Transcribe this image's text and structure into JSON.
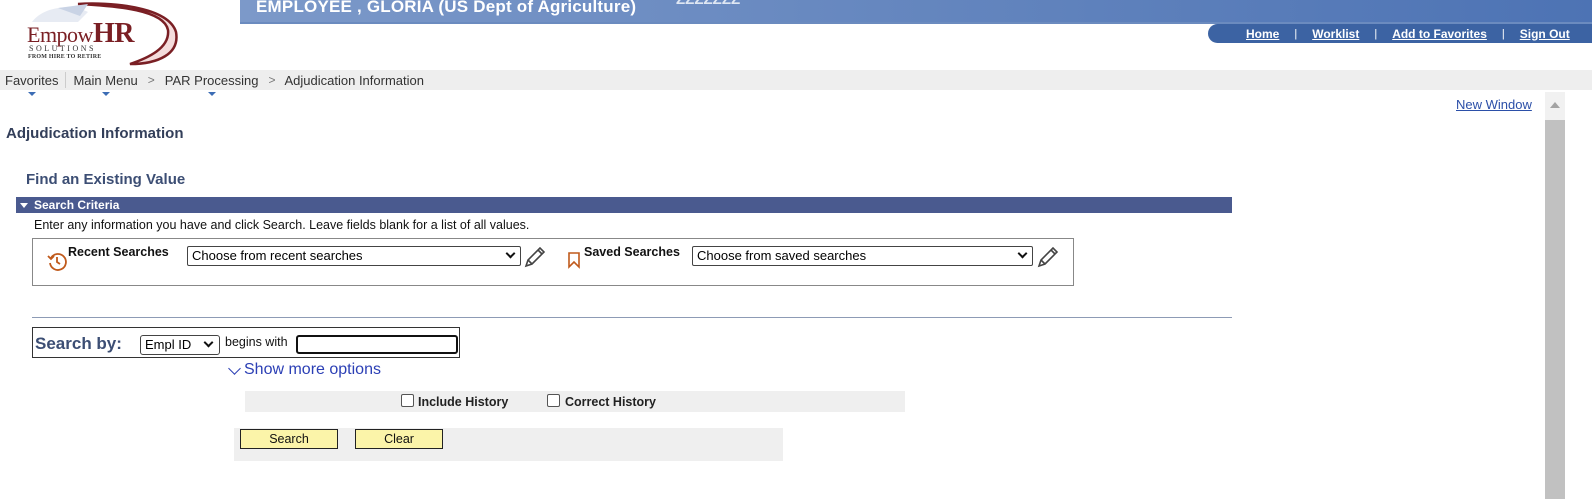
{
  "banner": {
    "title": "EMPLOYEE , GLORIA (US Dept of Agriculture)",
    "ghost": "ZZZZZZZ"
  },
  "logo": {
    "name_prefix": "Empow",
    "name_suffix": "HR",
    "sub": "SOLUTIONS",
    "tagline": "FROM HIRE TO RETIRE"
  },
  "nav": {
    "home": "Home",
    "worklist": "Worklist",
    "add_favorites": "Add to Favorites",
    "sign_out": "Sign Out",
    "separator": "|"
  },
  "breadcrumb": {
    "favorites": "Favorites",
    "main_menu": "Main Menu",
    "par_processing": "PAR Processing",
    "current": "Adjudication Information",
    "arrow": ">"
  },
  "page": {
    "new_window": "New Window",
    "title": "Adjudication Information",
    "find_title": "Find an Existing Value"
  },
  "criteria": {
    "header": "Search Criteria",
    "instructions": "Enter any information you have and click Search. Leave fields blank for a list of all values.",
    "recent_label": "Recent Searches",
    "recent_value": "Choose from recent searches",
    "saved_label": "Saved Searches",
    "saved_value": "Choose from saved searches"
  },
  "search_by": {
    "label": "Search by:",
    "field_value": "Empl ID",
    "operator": "begins with",
    "input_value": ""
  },
  "options": {
    "show_more": "Show more options",
    "include_history": "Include History",
    "correct_history": "Correct History",
    "include_history_checked": false,
    "correct_history_checked": false
  },
  "buttons": {
    "search": "Search",
    "clear": "Clear"
  },
  "colors": {
    "banner_blue": "#4d73b4",
    "criteria_bar": "#4a5a8f",
    "button_yellow": "#fbf4a9",
    "link_blue": "#2b3fb5",
    "logo_red": "#7a1f24"
  }
}
